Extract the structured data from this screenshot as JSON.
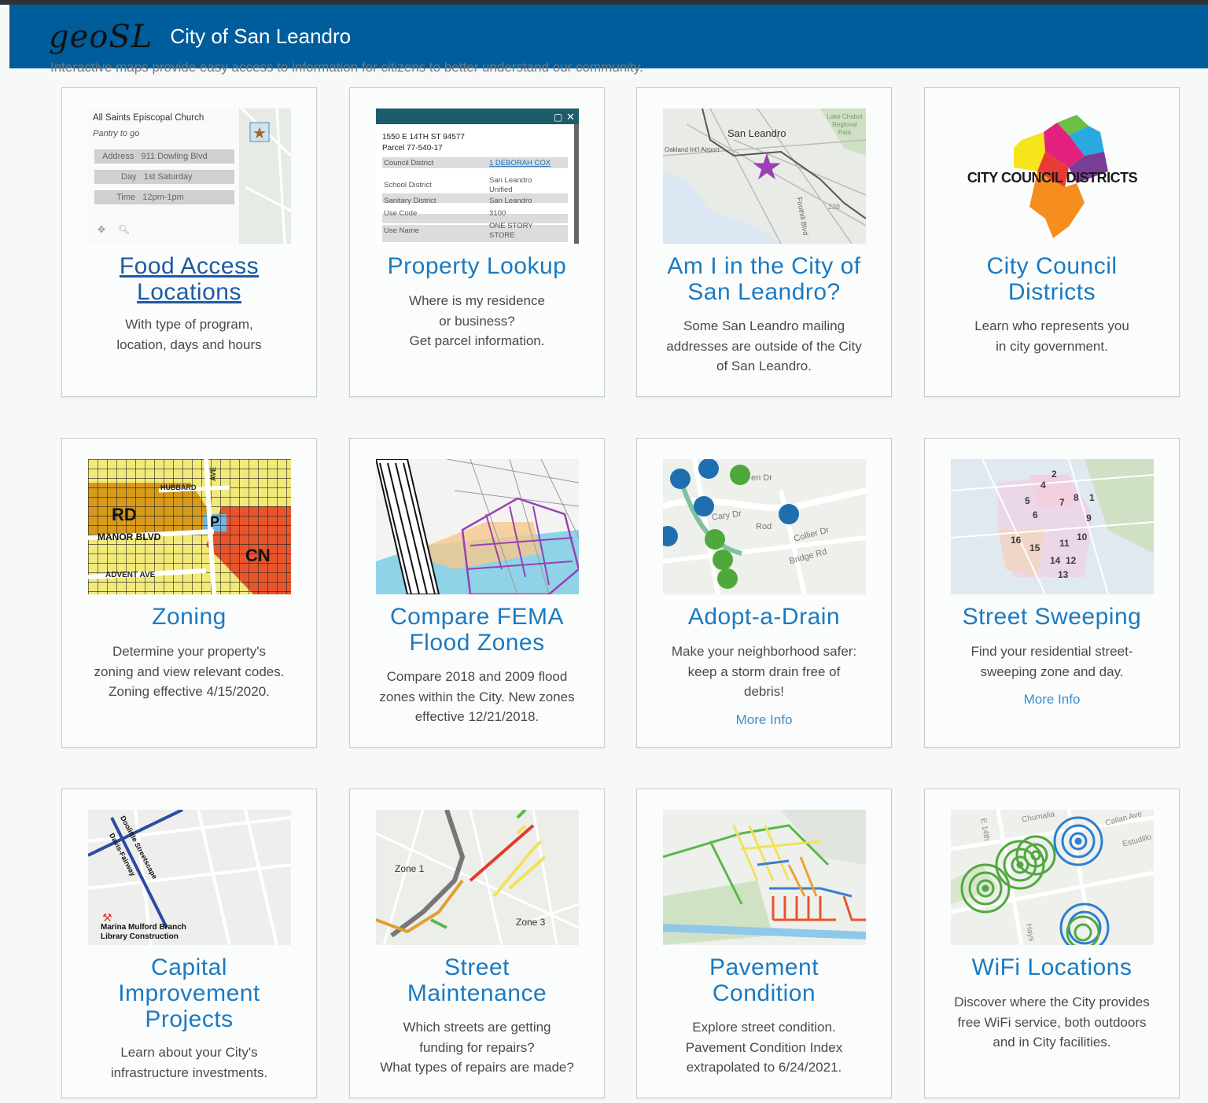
{
  "header": {
    "logo": "geoSL",
    "title": "City of San Leandro"
  },
  "subtitle": "Interactive maps provide easy access to information for citizens to better understand our community.",
  "cards": [
    {
      "title": "Food Access Locations",
      "desc_lines": [
        "With type of program,",
        "location, days and hours"
      ],
      "thumb": {
        "place": "All Saints Episcopal Church",
        "tagline": "Pantry to go",
        "rows": [
          {
            "label": "Address",
            "value": "911 Dowling Blvd"
          },
          {
            "label": "Day",
            "value": "1st Saturday"
          },
          {
            "label": "Time",
            "value": "12pm-1pm"
          }
        ]
      }
    },
    {
      "title": "Property Lookup",
      "desc_lines": [
        "Where is my residence",
        "or business?",
        "Get parcel information."
      ],
      "thumb": {
        "address": "1550 E 14TH ST 94577",
        "parcel": "Parcel 77-540-17",
        "rows": [
          {
            "label": "Council District",
            "value": "1 DEBORAH COX"
          },
          {
            "label": "School District",
            "value": "San Leandro Unified"
          },
          {
            "label": "Sanitary District",
            "value": "San Leandro"
          },
          {
            "label": "Use Code",
            "value": "3100"
          },
          {
            "label": "Use Name",
            "value": "ONE STORY STORE"
          }
        ]
      }
    },
    {
      "title": "Am I in the City of San Leandro?",
      "desc_lines": [
        "Some San Leandro mailing",
        "addresses are outside of the City",
        "of San Leandro."
      ],
      "thumb": {
        "city_label": "San Leandro",
        "airport": "Oakland Int'l Airport",
        "park": "Lake Chabot Regional Park",
        "street": "Foothill Blvd",
        "street2": "238"
      }
    },
    {
      "title": "City Council Districts",
      "desc_lines": [
        "Learn who represents you",
        "in city government."
      ],
      "thumb": {
        "banner": "CITY COUNCIL DISTRICTS"
      }
    },
    {
      "title": "Zoning",
      "desc_lines": [
        "Determine your property's",
        "zoning and view relevant codes.",
        "Zoning effective 4/15/2020."
      ],
      "thumb": {
        "labels": [
          "RD",
          "P",
          "CN",
          "HUBBARD",
          "MANOR BLVD",
          "ADVENT AVE",
          "AVE"
        ]
      }
    },
    {
      "title": "Compare FEMA Flood Zones",
      "desc_lines": [
        "Compare 2018 and 2009 flood",
        "zones within the City. New zones",
        "effective 12/21/2018."
      ]
    },
    {
      "title": "Adopt-a-Drain",
      "desc_lines": [
        "Make your neighborhood safer:",
        "keep a storm drain free of",
        "debris!"
      ],
      "more": "More Info",
      "thumb": {
        "streets": [
          "Cary Dr",
          "Collier Dr",
          "Bridge Rd",
          "Rod",
          "en Dr"
        ]
      }
    },
    {
      "title": "Street Sweeping",
      "desc_lines": [
        "Find your residential street-",
        "sweeping zone and day."
      ],
      "more": "More Info",
      "thumb": {
        "zones": [
          "2",
          "4",
          "7",
          "8",
          "1",
          "5",
          "6",
          "9",
          "10",
          "16",
          "15",
          "11",
          "14",
          "12",
          "13"
        ]
      }
    },
    {
      "title": "Capital Improvement Projects",
      "desc_lines": [
        "Learn about your City's",
        "infrastructure investments."
      ],
      "thumb": {
        "labels": [
          "Doolittle Streetscape",
          "Davis-Fairway",
          "Marina Mulford Branch",
          "Library Construction"
        ]
      }
    },
    {
      "title": "Street Maintenance",
      "desc_lines": [
        "Which streets are getting",
        "funding for repairs?",
        "What types of repairs are made?"
      ],
      "thumb": {
        "labels": [
          "Zone 1",
          "Zone 3"
        ]
      }
    },
    {
      "title": "Pavement Condition",
      "desc_lines": [
        "Explore street condition.",
        "Pavement Condition Index",
        "extrapolated to 6/24/2021."
      ]
    },
    {
      "title": "WiFi Locations",
      "desc_lines": [
        "Discover where the City provides",
        "free WiFi service, both outdoors",
        "and in City facilities."
      ],
      "thumb": {
        "streets": [
          "E 14th",
          "Callan Ave",
          "Estudillo",
          "Hays",
          "Chumalia"
        ]
      }
    }
  ],
  "colors": {
    "header": "#005d9c",
    "title": "#1c7ac0",
    "link": "#3a8fd0"
  }
}
